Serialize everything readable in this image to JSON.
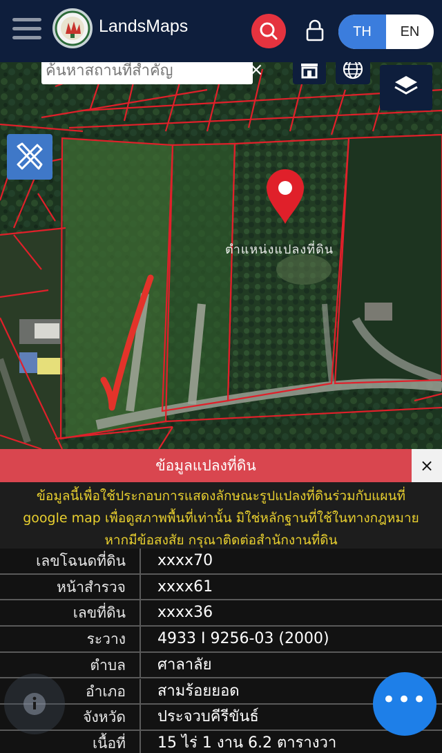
{
  "header": {
    "brand": "LandsMaps",
    "lang_th": "TH",
    "lang_en": "EN"
  },
  "map": {
    "search_placeholder": "ค้นหาสถานที่สำคัญ",
    "search_clear": "×",
    "pin_label": "ตำแหน่งแปลงที่ดิน"
  },
  "panel": {
    "title": "ข้อมูลแปลงที่ดิน",
    "close": "×",
    "notice_line1": "ข้อมูลนี้เพื่อใช้ประกอบการแสดงลักษณะรูปแปลงที่ดินร่วมกับแผนที่",
    "notice_line2": "google map เพื่อดูสภาพพื้นที่เท่านั้น มิใช่หลักฐานที่ใช้ในทางกฎหมาย",
    "notice_line3": "หากมีข้อสงสัย กรุณาติดต่อสำนักงานที่ดิน",
    "rows": [
      {
        "label": "เลขโฉนดที่ดิน",
        "value": "xxxx70"
      },
      {
        "label": "หน้าสำรวจ",
        "value": "xxxx61"
      },
      {
        "label": "เลขที่ดิน",
        "value": "xxxx36"
      },
      {
        "label": "ระวาง",
        "value": "4933 I 9256-03 (2000)"
      },
      {
        "label": "ตำบล",
        "value": "ศาลาลัย"
      },
      {
        "label": "อำเภอ",
        "value": "สามร้อยยอด"
      },
      {
        "label": "จังหวัด",
        "value": "ประจวบคีรีขันธ์"
      },
      {
        "label": "เนื้อที่",
        "value": "15 ไร่ 1 งาน 6.2 ตารางวา"
      }
    ]
  },
  "fab": {
    "more": "•••"
  },
  "colors": {
    "header_bg": "#0e1e3c",
    "accent_red": "#e5333f",
    "accent_blue": "#3b7ddd",
    "panel_red": "#d9464f",
    "notice_yellow": "#e9d02f",
    "parcel_line": "#e0202a"
  }
}
